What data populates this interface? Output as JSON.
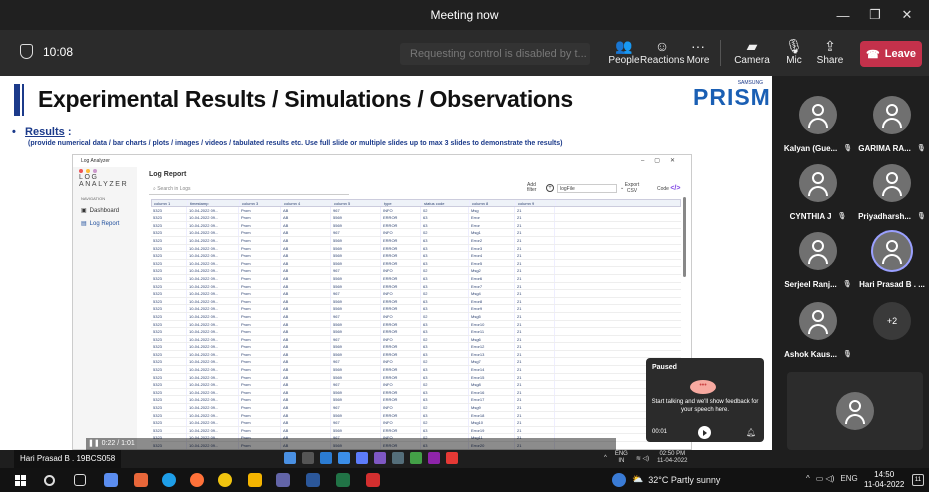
{
  "window": {
    "title": "Meeting now",
    "controls": [
      "—",
      "❐",
      "✕"
    ]
  },
  "toolbar": {
    "timer": "10:08",
    "request_control_text": "Requesting control is disabled by t...",
    "buttons": [
      {
        "label": "People",
        "icon": "people-icon"
      },
      {
        "label": "Reactions",
        "icon": "reactions-icon"
      },
      {
        "label": "More",
        "icon": "more-icon"
      },
      {
        "label": "Camera",
        "icon": "camera-off-icon"
      },
      {
        "label": "Mic",
        "icon": "mic-off-icon"
      },
      {
        "label": "Share",
        "icon": "share-icon"
      }
    ],
    "leave_label": "Leave",
    "leave_color": "#c4314b"
  },
  "slide": {
    "title": "Experimental Results / Simulations / Observations",
    "brand": "PRISM",
    "brand_top": "SAMSUNG",
    "bullet_heading": "Results",
    "bullet_colon": " :",
    "description": "(provide numerical data / bar charts / plots / images / videos / tabulated results etc. Use full slide or multiple slides up to max 3 slides to demonstrate the results)",
    "accent_color": "#1b3a8a"
  },
  "app": {
    "window_title": "Log Analyzer",
    "brand": "LOG ANALYZER",
    "nav_heading": "NAVIGATION",
    "nav_items": [
      "Dashboard",
      "Log Report"
    ],
    "page_title": "Log Report",
    "search_placeholder": "Search in Logs",
    "add_filter_label": "Add filter",
    "combo_value": "logFile",
    "export_label": "Export CSV",
    "code_label": "Code",
    "columns": [
      "column 1",
      "timestamp",
      "column 3",
      "column 4",
      "column 5",
      "type",
      "status code",
      "column 8",
      "column 9"
    ],
    "rows": [
      [
        "5323",
        "10-04-2022 09...",
        "Prom",
        "AB",
        "967",
        "INFO",
        "02",
        "Msg",
        "21"
      ],
      [
        "5323",
        "10-04-2022 09...",
        "Prom",
        "AB",
        "5569",
        "ERROR",
        "63",
        "Error",
        "21"
      ],
      [
        "5323",
        "10-04-2022 09...",
        "Prom",
        "AB",
        "5569",
        "ERROR",
        "63",
        "Error",
        "21"
      ],
      [
        "5323",
        "10-04-2022 09...",
        "Prom",
        "AB",
        "967",
        "INFO",
        "02",
        "Msg1",
        "21"
      ],
      [
        "5323",
        "10-04-2022 09...",
        "Prom",
        "AB",
        "5569",
        "ERROR",
        "63",
        "Error2",
        "21"
      ],
      [
        "5323",
        "10-04-2022 09...",
        "Prom",
        "AB",
        "5569",
        "ERROR",
        "63",
        "Error3",
        "21"
      ],
      [
        "5323",
        "10-04-2022 09...",
        "Prom",
        "AB",
        "5569",
        "ERROR",
        "63",
        "Error4",
        "21"
      ],
      [
        "5323",
        "10-04-2022 09...",
        "Prom",
        "AB",
        "5569",
        "ERROR",
        "63",
        "Error5",
        "21"
      ],
      [
        "5323",
        "10-04-2022 09...",
        "Prom",
        "AB",
        "967",
        "INFO",
        "02",
        "Msg2",
        "21"
      ],
      [
        "5323",
        "10-04-2022 09...",
        "Prom",
        "AB",
        "5569",
        "ERROR",
        "63",
        "Error6",
        "21"
      ],
      [
        "5323",
        "10-04-2022 09...",
        "Prom",
        "AB",
        "5569",
        "ERROR",
        "63",
        "Error7",
        "21"
      ],
      [
        "5323",
        "10-04-2022 09...",
        "Prom",
        "AB",
        "967",
        "INFO",
        "02",
        "Msg4",
        "21"
      ],
      [
        "5323",
        "10-04-2022 09...",
        "Prom",
        "AB",
        "5569",
        "ERROR",
        "63",
        "Error8",
        "21"
      ],
      [
        "5323",
        "10-04-2022 09...",
        "Prom",
        "AB",
        "5569",
        "ERROR",
        "63",
        "Error9",
        "21"
      ],
      [
        "5323",
        "10-04-2022 09...",
        "Prom",
        "AB",
        "967",
        "INFO",
        "02",
        "Msg5",
        "21"
      ],
      [
        "5323",
        "10-04-2022 09...",
        "Prom",
        "AB",
        "5569",
        "ERROR",
        "63",
        "Error10",
        "21"
      ],
      [
        "5323",
        "10-04-2022 09...",
        "Prom",
        "AB",
        "5569",
        "ERROR",
        "63",
        "Error11",
        "21"
      ],
      [
        "5323",
        "10-04-2022 09...",
        "Prom",
        "AB",
        "967",
        "INFO",
        "02",
        "Msg6",
        "21"
      ],
      [
        "5323",
        "10-04-2022 09...",
        "Prom",
        "AB",
        "5569",
        "ERROR",
        "63",
        "Error12",
        "21"
      ],
      [
        "5323",
        "10-04-2022 09...",
        "Prom",
        "AB",
        "5569",
        "ERROR",
        "63",
        "Error13",
        "21"
      ],
      [
        "5323",
        "10-04-2022 09...",
        "Prom",
        "AB",
        "967",
        "INFO",
        "02",
        "Msg7",
        "21"
      ],
      [
        "5323",
        "10-04-2022 09...",
        "Prom",
        "AB",
        "5569",
        "ERROR",
        "63",
        "Error14",
        "21"
      ],
      [
        "5323",
        "10-04-2022 09...",
        "Prom",
        "AB",
        "5569",
        "ERROR",
        "63",
        "Error15",
        "21"
      ],
      [
        "5323",
        "10-04-2022 09...",
        "Prom",
        "AB",
        "967",
        "INFO",
        "02",
        "Msg8",
        "21"
      ],
      [
        "5323",
        "10-04-2022 09...",
        "Prom",
        "AB",
        "5569",
        "ERROR",
        "63",
        "Error16",
        "21"
      ],
      [
        "5323",
        "10-04-2022 09...",
        "Prom",
        "AB",
        "5569",
        "ERROR",
        "63",
        "Error17",
        "21"
      ],
      [
        "5323",
        "10-04-2022 09...",
        "Prom",
        "AB",
        "967",
        "INFO",
        "02",
        "Msg9",
        "21"
      ],
      [
        "5323",
        "10-04-2022 09...",
        "Prom",
        "AB",
        "5569",
        "ERROR",
        "63",
        "Error18",
        "21"
      ],
      [
        "5323",
        "10-04-2022 09...",
        "Prom",
        "AB",
        "967",
        "INFO",
        "02",
        "Msg10",
        "21"
      ],
      [
        "5323",
        "10-04-2022 09...",
        "Prom",
        "AB",
        "5569",
        "ERROR",
        "63",
        "Error19",
        "21"
      ],
      [
        "5323",
        "10-04-2022 09...",
        "Prom",
        "AB",
        "967",
        "INFO",
        "02",
        "Msg11",
        "21"
      ],
      [
        "5323",
        "10-04-2022 09...",
        "Prom",
        "AB",
        "5569",
        "ERROR",
        "63",
        "Error20",
        "21"
      ],
      [
        "5323",
        "10-04-2022 09...",
        "Prom",
        "AB",
        "967",
        "INFO",
        "02",
        "Msg12",
        "21"
      ],
      [
        "5323",
        "10-04-2022 09...",
        "Prom",
        "AB",
        "5569",
        "ERROR",
        "63",
        "Error21",
        "21"
      ]
    ],
    "video_time": "❚❚  0:22 / 1:01"
  },
  "coach": {
    "status": "Paused",
    "message": "Start talking and we'll show feedback for your speech here.",
    "time": "00:01"
  },
  "presenter": {
    "name": "Hari Prasad B . 19BCS058",
    "lang": "ENG",
    "lang_sub": "IN",
    "time": "02:50 PM",
    "date": "11-04-2022"
  },
  "participants": [
    {
      "name": "Kalyan (Gue...",
      "muted": true
    },
    {
      "name": "GARIMA RA...",
      "muted": true
    },
    {
      "name": "CYNTHIA J",
      "muted": true
    },
    {
      "name": "Priyadharsh...",
      "muted": true
    },
    {
      "name": "Serjeel Ranj...",
      "muted": true
    },
    {
      "name": "Hari Prasad B . ...",
      "muted": false,
      "active": true
    },
    {
      "name": "Ashok Kaus...",
      "muted": true
    }
  ],
  "more_participants": "+2",
  "taskbar": {
    "weather": "32°C  Partly sunny",
    "lang": "ENG",
    "time": "14:50",
    "date": "11-04-2022",
    "notif_count": "11"
  }
}
